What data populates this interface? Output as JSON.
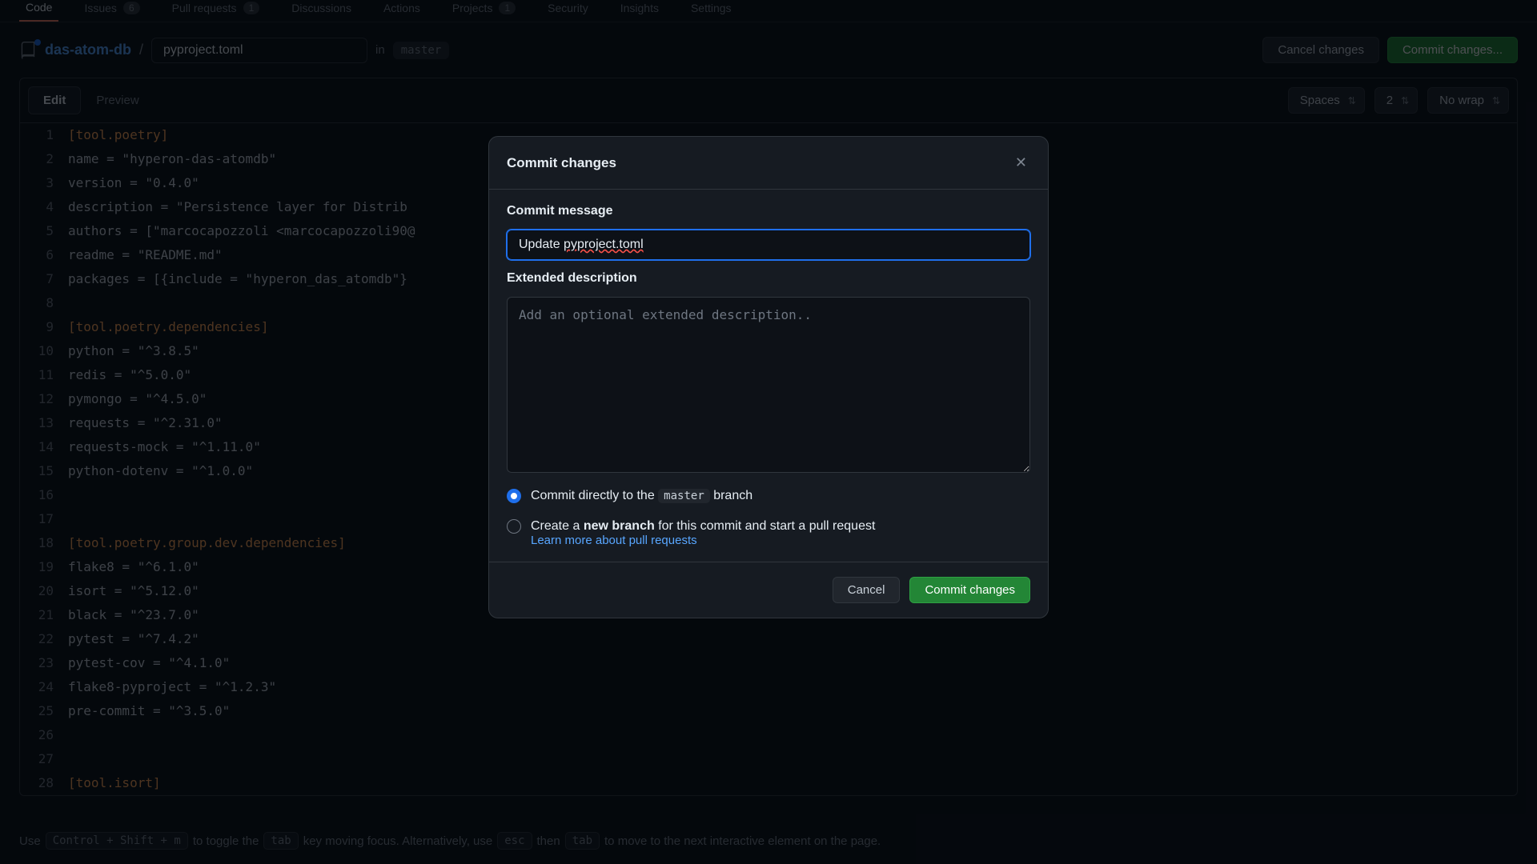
{
  "nav": {
    "tabs": [
      "Code",
      "Issues",
      "Pull requests",
      "Discussions",
      "Actions",
      "Projects",
      "Security",
      "Insights",
      "Settings"
    ],
    "issues_count": "6",
    "pr_count": "1",
    "projects_count": "1"
  },
  "filebar": {
    "repo": "das-atom-db",
    "filename": "pyproject.toml",
    "in": "in",
    "branch": "master",
    "cancel": "Cancel changes",
    "commit": "Commit changes..."
  },
  "toolbar": {
    "edit": "Edit",
    "preview": "Preview",
    "indent": "Spaces",
    "indent_size": "2",
    "wrap": "No wrap"
  },
  "code": {
    "lines": [
      "[tool.poetry]",
      "name = \"hyperon-das-atomdb\"",
      "version = \"0.4.0\"",
      "description = \"Persistence layer for Distrib",
      "authors = [\"marcocapozzoli <marcocapozzoli90@",
      "readme = \"README.md\"",
      "packages = [{include = \"hyperon_das_atomdb\"}",
      "",
      "[tool.poetry.dependencies]",
      "python = \"^3.8.5\"",
      "redis = \"^5.0.0\"",
      "pymongo = \"^4.5.0\"",
      "requests = \"^2.31.0\"",
      "requests-mock = \"^1.11.0\"",
      "python-dotenv = \"^1.0.0\"",
      "",
      "",
      "[tool.poetry.group.dev.dependencies]",
      "flake8 = \"^6.1.0\"",
      "isort = \"^5.12.0\"",
      "black = \"^23.7.0\"",
      "pytest = \"^7.4.2\"",
      "pytest-cov = \"^4.1.0\"",
      "flake8-pyproject = \"^1.2.3\"",
      "pre-commit = \"^3.5.0\"",
      "",
      "",
      "[tool.isort]"
    ]
  },
  "hint": {
    "p1": "Use",
    "kb1": "Control + Shift + m",
    "p2": "to toggle the",
    "kb2": "tab",
    "p3": "key moving focus. Alternatively, use",
    "kb3": "esc",
    "p4": "then",
    "kb4": "tab",
    "p5": "to move to the next interactive element on the page."
  },
  "modal": {
    "title": "Commit changes",
    "commit_msg_label": "Commit message",
    "commit_msg_value": "Update pyproject.toml",
    "ext_desc_label": "Extended description",
    "ext_desc_placeholder": "Add an optional extended description..",
    "radio1_pre": "Commit directly to the",
    "radio1_branch": "master",
    "radio1_post": "branch",
    "radio2_pre": "Create a",
    "radio2_bold": "new branch",
    "radio2_post": "for this commit and start a pull request",
    "learn_more": "Learn more about pull requests",
    "cancel": "Cancel",
    "commit": "Commit changes"
  }
}
